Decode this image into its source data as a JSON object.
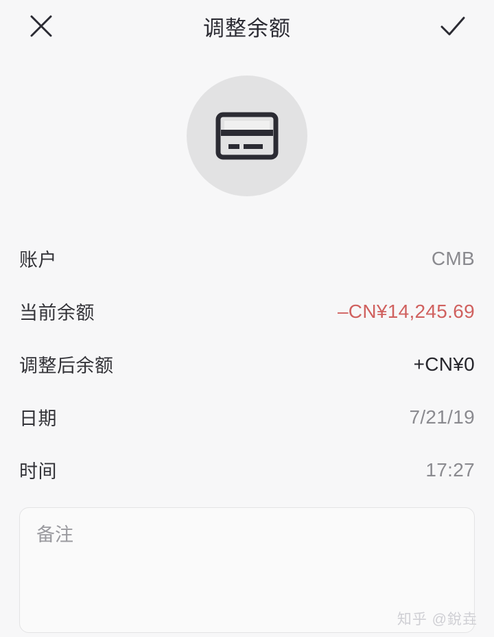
{
  "header": {
    "title": "调整余额",
    "close_icon": "close-x-icon",
    "confirm_icon": "check-icon"
  },
  "avatar": {
    "icon": "credit-card-icon",
    "circle_color": "#e2e2e3",
    "icon_color": "#2b2b33"
  },
  "rows": [
    {
      "label": "账户",
      "value": "CMB",
      "style": "muted"
    },
    {
      "label": "当前余额",
      "value": "–CN¥14,245.69",
      "style": "negative"
    },
    {
      "label": "调整后余额",
      "value": "+CN¥0",
      "style": "strong"
    },
    {
      "label": "日期",
      "value": "7/21/19",
      "style": "muted"
    },
    {
      "label": "时间",
      "value": "17:27",
      "style": "muted"
    }
  ],
  "notes": {
    "placeholder": "备注",
    "value": ""
  },
  "watermark": {
    "text": "知乎 @銳垚"
  },
  "colors": {
    "background": "#f7f7f8",
    "label": "#333338",
    "value_muted": "#8a8a8f",
    "value_negative": "#d0615f",
    "value_strong": "#26262c",
    "border": "#e3e3e4"
  }
}
